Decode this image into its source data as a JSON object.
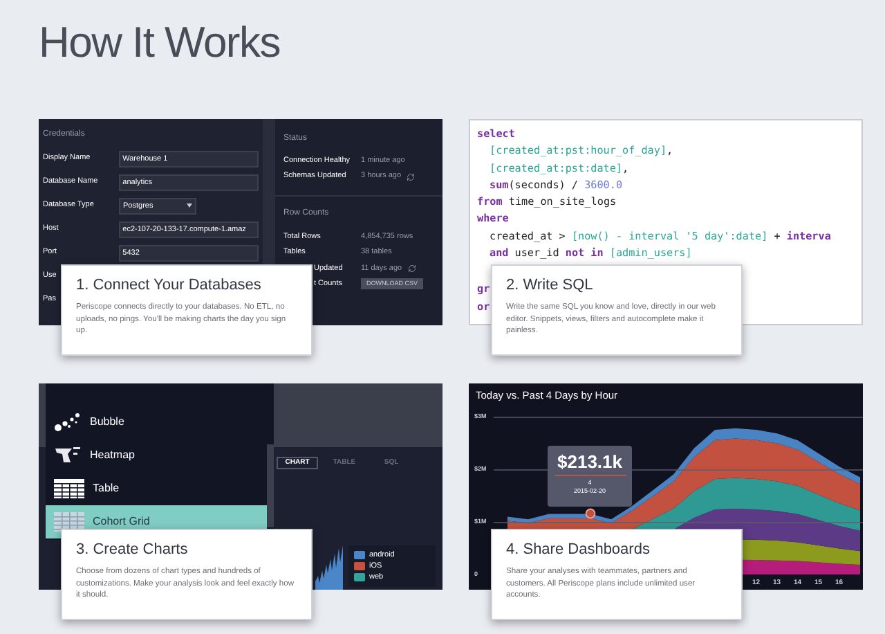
{
  "page_title": "How It Works",
  "sections": [
    {
      "kind": "database",
      "caption": {
        "title": "1. Connect Your Databases",
        "description": "Periscope connects directly to your databases. No ETL, no uploads, no pings. You'll be making charts the day you sign up."
      },
      "credentials_title": "Credentials",
      "fields": [
        {
          "label": "Display Name",
          "value": "Warehouse 1",
          "kind": "text"
        },
        {
          "label": "Database Name",
          "value": "analytics",
          "kind": "text"
        },
        {
          "label": "Database Type",
          "value": "Postgres",
          "kind": "select"
        },
        {
          "label": "Host",
          "value": "ec2-107-20-133-17.compute-1.amaz",
          "kind": "text"
        },
        {
          "label": "Port",
          "value": "5432",
          "kind": "text"
        },
        {
          "label": "Use",
          "kind": "covered"
        },
        {
          "label": "Pas",
          "kind": "covered"
        }
      ],
      "status_title": "Status",
      "status_rows": [
        {
          "label": "Connection Healthy",
          "value": "1 minute ago"
        },
        {
          "label": "Schemas Updated",
          "value": "3 hours ago",
          "refresh": true
        }
      ],
      "row_counts_title": "Row Counts",
      "count_rows": [
        {
          "label": "Total Rows",
          "value": "4,854,735 rows"
        },
        {
          "label": "Tables",
          "value": "38 tables"
        },
        {
          "label": "Updated",
          "value": "11 days ago",
          "refresh": true
        },
        {
          "label": "t Counts",
          "button": "DOWNLOAD CSV"
        }
      ]
    },
    {
      "kind": "sql",
      "caption": {
        "title": "2. Write SQL",
        "description": "Write the same SQL you know and love, directly in our web editor. Snippets, views, filters and autocomplete make it painless."
      },
      "code_lines": [
        {
          "indent": false,
          "tokens": [
            {
              "kind": "keyword",
              "text": "select"
            }
          ]
        },
        {
          "indent": true,
          "tokens": [
            {
              "kind": "ref",
              "text": "[created_at:pst:hour_of_day]"
            },
            {
              "kind": "plain",
              "text": ","
            }
          ]
        },
        {
          "indent": true,
          "tokens": [
            {
              "kind": "ref",
              "text": "[created_at:pst:date]"
            },
            {
              "kind": "plain",
              "text": ","
            }
          ]
        },
        {
          "indent": true,
          "tokens": [
            {
              "kind": "keyword",
              "text": "sum"
            },
            {
              "kind": "plain",
              "text": "(seconds) / "
            },
            {
              "kind": "number",
              "text": "3600.0"
            }
          ]
        },
        {
          "indent": false,
          "tokens": [
            {
              "kind": "keyword",
              "text": "from"
            },
            {
              "kind": "plain",
              "text": " time_on_site_logs"
            }
          ]
        },
        {
          "indent": false,
          "tokens": [
            {
              "kind": "keyword",
              "text": "where"
            }
          ]
        },
        {
          "indent": true,
          "tokens": [
            {
              "kind": "plain",
              "text": "created_at > "
            },
            {
              "kind": "ref",
              "text": "[now() - interval '5 day':date]"
            },
            {
              "kind": "plain",
              "text": " + "
            },
            {
              "kind": "keyword",
              "text": "interva"
            }
          ]
        },
        {
          "indent": true,
          "tokens": [
            {
              "kind": "keyword",
              "text": "and"
            },
            {
              "kind": "plain",
              "text": " user_id "
            },
            {
              "kind": "keyword",
              "text": "not in "
            },
            {
              "kind": "ref",
              "text": "[admin_users]"
            }
          ]
        },
        {
          "indent": false,
          "tokens": [
            {
              "kind": "keyword",
              "text": "gr"
            }
          ]
        },
        {
          "indent": false,
          "tokens": [
            {
              "kind": "keyword",
              "text": "or"
            }
          ]
        }
      ]
    },
    {
      "kind": "charts",
      "caption": {
        "title": "3. Create Charts",
        "description": "Choose from dozens of chart types and hundreds of customizations. Make your analysis look and feel exactly how it should."
      },
      "chart_types": [
        {
          "label": "Bubble",
          "kind": "bubble",
          "selected": false
        },
        {
          "label": "Heatmap",
          "kind": "heatmap",
          "selected": false
        },
        {
          "label": "Table",
          "kind": "table",
          "selected": false
        },
        {
          "label": "Cohort Grid",
          "kind": "cohort",
          "selected": true
        }
      ],
      "view_tabs": [
        {
          "label": "CHART",
          "selected": true
        },
        {
          "label": "TABLE",
          "selected": false
        },
        {
          "label": "SQL",
          "selected": false
        }
      ],
      "legend": [
        {
          "label": "android",
          "color": "#4a86c8"
        },
        {
          "label": "iOS",
          "color": "#c8503e"
        },
        {
          "label": "web",
          "color": "#34a39b"
        }
      ]
    },
    {
      "kind": "dashboard",
      "caption": {
        "title": "4. Share Dashboards",
        "description": "Share your analyses with teammates, partners and customers. All Periscope plans include unlimited user accounts."
      },
      "chart": {
        "title": "Today vs. Past 4 Days by Hour",
        "y_ticks": [
          "$3M",
          "$2M",
          "$1M",
          "0"
        ],
        "x_ticks": [
          "12",
          "13",
          "14",
          "15",
          "16"
        ],
        "tooltip": {
          "value": "$213.1k",
          "hour": "4",
          "date": "2015-02-20"
        }
      }
    }
  ]
}
